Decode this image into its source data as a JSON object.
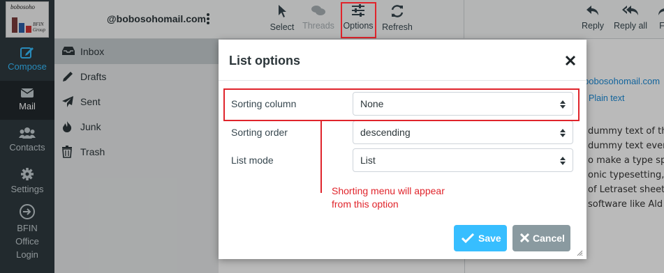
{
  "logo": {
    "line1": "bobosoho",
    "line2": "BFIN Group"
  },
  "nav": [
    {
      "label": "Compose",
      "icon": "compose-icon"
    },
    {
      "label": "Mail",
      "icon": "envelope-icon"
    },
    {
      "label": "Contacts",
      "icon": "users-icon"
    },
    {
      "label": "Settings",
      "icon": "gear-icon"
    },
    {
      "label": "BFIN Office Login",
      "icon": "sign-in-icon"
    }
  ],
  "account": {
    "email": "@bobosohomail.com"
  },
  "folders": [
    {
      "label": "Inbox",
      "icon": "inbox-icon",
      "selected": true
    },
    {
      "label": "Drafts",
      "icon": "pencil-icon"
    },
    {
      "label": "Sent",
      "icon": "paper-plane-icon"
    },
    {
      "label": "Junk",
      "icon": "fire-icon"
    },
    {
      "label": "Trash",
      "icon": "trash-icon"
    }
  ],
  "toolbar": {
    "select": "Select",
    "threads": "Threads",
    "options": "Options",
    "refresh": "Refresh",
    "reply": "Reply",
    "reply_all": "Reply all",
    "forward_partial": "F"
  },
  "preview": {
    "email_partial": "bobosohomail.com",
    "plain_text": "Plain text",
    "lines": [
      "dummy text of th",
      "dummy text ever",
      "o make a type sp",
      "onic typesetting,",
      "of Letraset sheet",
      "software like Ald"
    ]
  },
  "dialog": {
    "title": "List options",
    "rows": [
      {
        "label": "Sorting column",
        "value": "None"
      },
      {
        "label": "Sorting order",
        "value": "descending"
      },
      {
        "label": "List mode",
        "value": "List"
      }
    ],
    "annotation": "Shorting menu will appear from this option",
    "save": "Save",
    "cancel": "Cancel"
  },
  "colors": {
    "accent": "#37beff",
    "annotation": "#e0242b",
    "rail": "#2f3a3f"
  }
}
